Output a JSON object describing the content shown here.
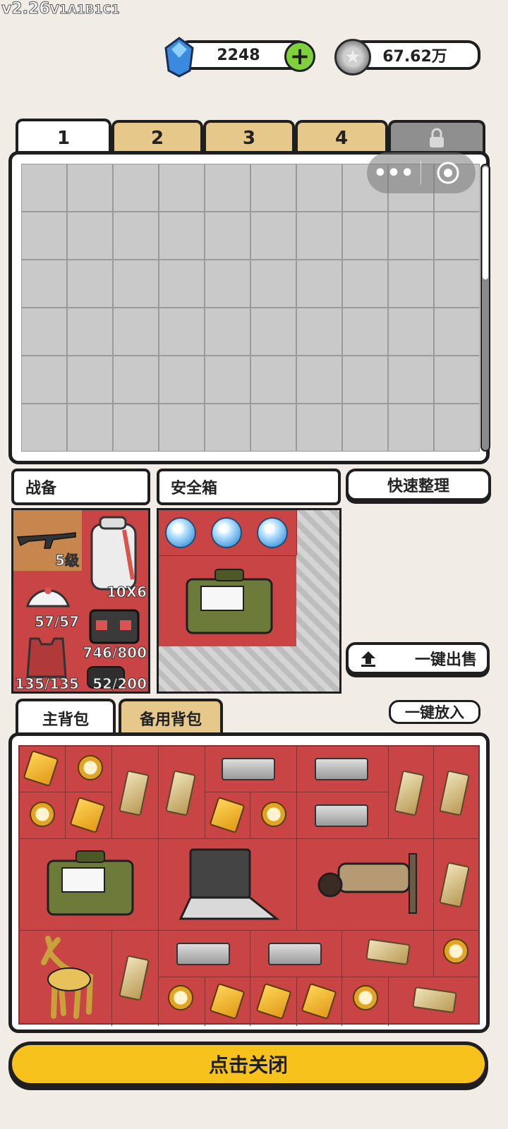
{
  "version": {
    "main": "v2.26",
    "sub": "V1A1B1C1"
  },
  "currency": {
    "gems": "2248",
    "coins": "67.62万"
  },
  "storage_tabs": [
    "1",
    "2",
    "3",
    "4"
  ],
  "sections": {
    "gear": "战备",
    "safe_box": "安全箱",
    "quick_sort": "快速整理",
    "sell_all": "一键出售",
    "put_all": "一键放入"
  },
  "gear_stats": {
    "weapon_level": "5级",
    "backpack_size": "10X6",
    "helmet": "57/57",
    "rig": "746/800",
    "armor": "135/135",
    "case": "52/200"
  },
  "bag_tabs": {
    "main": "主背包",
    "spare": "备用背包"
  },
  "close_button": "点击关闭",
  "colors": {
    "accent_yellow": "#f7c21c",
    "item_bg_red": "#c94444",
    "tab_yellow": "#e6c88a",
    "green_plus": "#7fd13b"
  }
}
